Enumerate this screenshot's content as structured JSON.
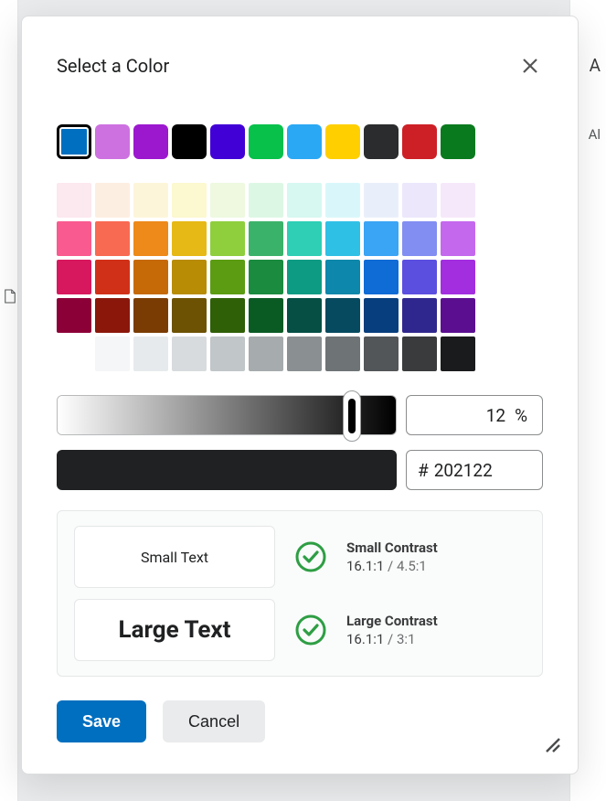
{
  "background": {
    "right_text_1": "A",
    "right_text_2": "Al"
  },
  "dialog": {
    "title": "Select a Color",
    "close_icon": "close-icon",
    "presets": [
      {
        "color": "#006fbf",
        "selected": true
      },
      {
        "color": "#cd71e0"
      },
      {
        "color": "#9c18cf"
      },
      {
        "color": "#000000"
      },
      {
        "color": "#4100d6"
      },
      {
        "color": "#07c14b"
      },
      {
        "color": "#2ba8f3"
      },
      {
        "color": "#ffcf00"
      },
      {
        "color": "#2b2c2d"
      },
      {
        "color": "#cd2026"
      },
      {
        "color": "#0a7a1e"
      }
    ],
    "grid": [
      [
        "#fce8ef",
        "#fdeee2",
        "#fdf5d9",
        "#fcf8cf",
        "#eef9df",
        "#ddf7e5",
        "#d6f8f0",
        "#d9f7fb",
        "#e9effa",
        "#ece7fb",
        "#f6e8fb"
      ],
      [
        "#f95a8f",
        "#f96a52",
        "#ed8a1a",
        "#e6b916",
        "#8fcf3e",
        "#3bb26a",
        "#2ecfb5",
        "#2fc0e6",
        "#3aa4f5",
        "#828ef1",
        "#c468ee"
      ],
      [
        "#d8185e",
        "#d13018",
        "#c66a08",
        "#b88c05",
        "#5b9c12",
        "#1a8b3f",
        "#0e9b84",
        "#0d87ab",
        "#0f6bd6",
        "#5b4fe0",
        "#a22ee0"
      ],
      [
        "#8c0038",
        "#8a170a",
        "#7a3c03",
        "#6c5202",
        "#2f5f07",
        "#0a5a24",
        "#054f45",
        "#064a5f",
        "#073e7d",
        "#30278e",
        "#5b0f90"
      ],
      [
        "#ffffff",
        "#f4f6f7",
        "#e7eaec",
        "#d7dbdd",
        "#c1c6c8",
        "#a6abad",
        "#8a8f91",
        "#6e7375",
        "#535658",
        "#393b3c",
        "#1a1b1c"
      ]
    ],
    "brightness": {
      "value": "12",
      "suffix": "%",
      "thumb_left_pct": 87
    },
    "preview_color": "#202122",
    "hex": {
      "prefix": "#",
      "value": "202122"
    },
    "contrast": {
      "small": {
        "sample": "Small Text",
        "label": "Small Contrast",
        "ratio": "16.1:1",
        "sep": " / ",
        "threshold": "4.5:1",
        "pass": true
      },
      "large": {
        "sample": "Large Text",
        "label": "Large Contrast",
        "ratio": "16.1:1",
        "sep": " / ",
        "threshold": "3:1",
        "pass": true
      }
    },
    "footer": {
      "save": "Save",
      "cancel": "Cancel"
    }
  }
}
